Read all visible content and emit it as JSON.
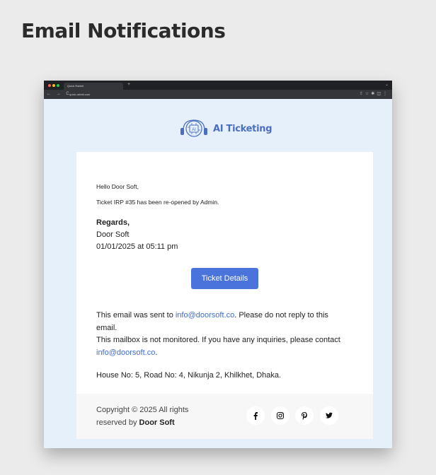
{
  "heading": "Email Notifications",
  "browser": {
    "tab_title": "Quick Rabbit",
    "new_tab": "+",
    "nav": "← → C",
    "url": "quick-rabbit.com"
  },
  "logo_text": "AI Ticketing",
  "email": {
    "greeting": "Hello Door Soft,",
    "message": "Ticket IRP #35 has been re-opened by Admin.",
    "regards_label": "Regards,",
    "regards_name": "Door Soft",
    "regards_date": "01/01/2025 at 05:11 pm",
    "button_label": "Ticket Details",
    "notice_prefix": "This email was sent to ",
    "notice_email": "info@doorsoft.co",
    "notice_suffix": ". Please do not reply to this email.",
    "mailbox_text": "This mailbox is not monitored. If you have any inquiries, please contact ",
    "mailbox_email": "info@doorsoft.co",
    "mailbox_end": ".",
    "address": "House No: 5, Road No: 4, Nikunja 2, Khilkhet, Dhaka."
  },
  "footer": {
    "copyright_prefix": "Copyright © 2025 All rights reserved by ",
    "company": "Door Soft",
    "social_icons": [
      "facebook-icon",
      "instagram-icon",
      "pinterest-icon",
      "twitter-icon"
    ]
  },
  "colors": {
    "accent": "#4a73dc",
    "link": "#3f6cd1",
    "logo": "#4a6fc0",
    "background": "#e6f0fb"
  }
}
